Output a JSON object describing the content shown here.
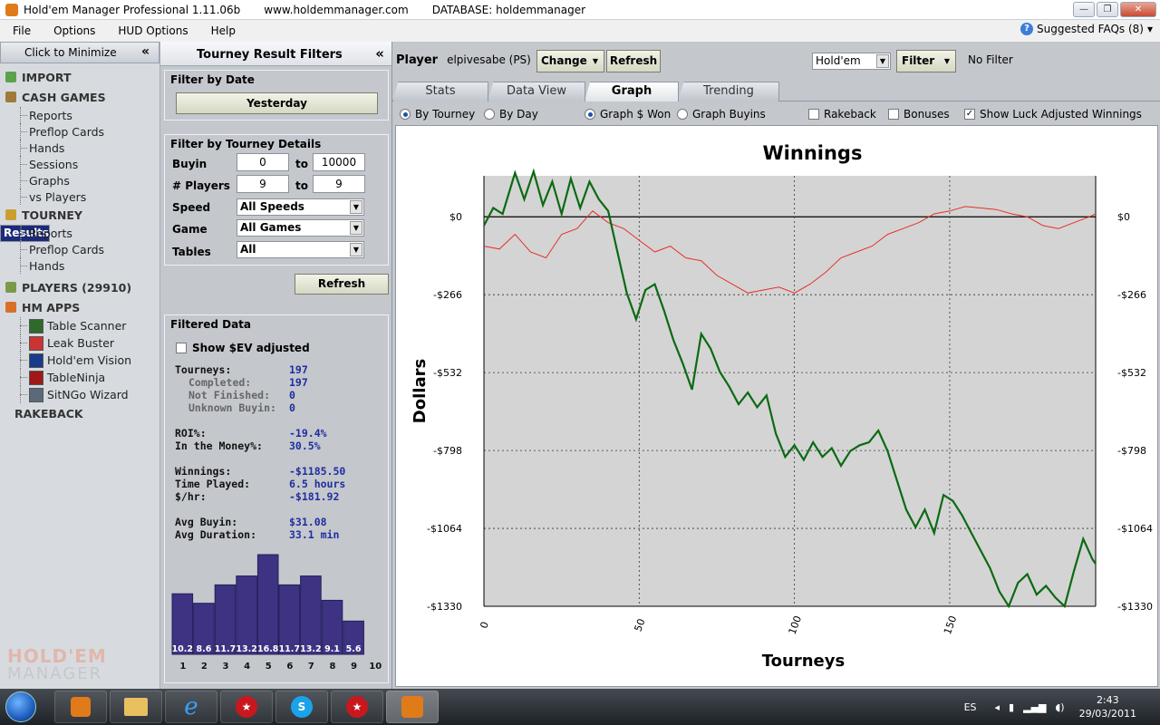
{
  "titlebar": {
    "app_title": "Hold'em Manager Professional 1.11.06b",
    "website": "www.holdemmanager.com",
    "database": "DATABASE: holdemmanager"
  },
  "menu": {
    "file": "File",
    "options": "Options",
    "hud_options": "HUD Options",
    "help": "Help",
    "faqs": "Suggested FAQs (8)"
  },
  "sidebar": {
    "minimize_label": "Click to Minimize",
    "import": "IMPORT",
    "cash_games": "CASH GAMES",
    "cash_items": [
      "Reports",
      "Preflop Cards",
      "Hands",
      "Sessions",
      "Graphs",
      "vs Players"
    ],
    "tourney": "TOURNEY",
    "tourney_items": [
      "Results",
      "Reports",
      "Preflop Cards",
      "Hands"
    ],
    "players": "PLAYERS (29910)",
    "hm_apps": "HM APPS",
    "apps": [
      "Table Scanner",
      "Leak Buster",
      "Hold'em Vision",
      "TableNinja",
      "SitNGo Wizard"
    ],
    "rakeback": "RAKEBACK",
    "logo_top": "HOLD'EM",
    "logo_bottom": "MANAGER"
  },
  "filters": {
    "title": "Tourney Result Filters",
    "by_date_title": "Filter by Date",
    "date_button": "Yesterday",
    "details_title": "Filter by Tourney Details",
    "buyin_label": "Buyin",
    "buyin_from": "0",
    "buyin_to": "10000",
    "players_label": "# Players",
    "players_from": "9",
    "players_to": "9",
    "to": "to",
    "speed_label": "Speed",
    "speed_value": "All Speeds",
    "game_label": "Game",
    "game_value": "All Games",
    "tables_label": "Tables",
    "tables_value": "All",
    "refresh": "Refresh",
    "filtered_title": "Filtered Data",
    "show_sev": "Show $EV adjusted",
    "stats": {
      "tourneys_label": "Tourneys:",
      "tourneys": "197",
      "completed_label": "Completed:",
      "completed": "197",
      "not_finished_label": "Not Finished:",
      "not_finished": "0",
      "unknown_label": "Unknown Buyin:",
      "unknown": "0",
      "roi_label": "ROI%:",
      "roi": "-19.4%",
      "itm_label": "In the Money%:",
      "itm": "30.5%",
      "winnings_label": "Winnings:",
      "winnings": "-$1185.50",
      "time_label": "Time Played:",
      "time": "6.5 hours",
      "hr_label": "$/hr:",
      "hr": "-$181.92",
      "avg_buyin_label": "Avg Buyin:",
      "avg_buyin": "$31.08",
      "avg_duration_label": "Avg Duration:",
      "avg_duration": "33.1 min"
    },
    "finish_histogram": {
      "positions": [
        "1",
        "2",
        "3",
        "4",
        "5",
        "6",
        "7",
        "8",
        "9",
        "10"
      ],
      "values": [
        10.2,
        8.6,
        11.7,
        13.2,
        16.8,
        11.7,
        13.2,
        9.1,
        5.6,
        null
      ],
      "labels": [
        "10.2",
        "8.6",
        "11.7",
        "13.2",
        "16.8",
        "11.7",
        "13.2",
        "9.1",
        "5.6",
        ""
      ],
      "max": 16.8
    }
  },
  "main": {
    "player_label": "Player",
    "player_name": "elpivesabe (PS)",
    "change": "Change",
    "refresh": "Refresh",
    "game_select": "Hold'em",
    "filter": "Filter",
    "no_filter": "No Filter",
    "tabs": [
      "Stats",
      "Data View",
      "Graph",
      "Trending"
    ],
    "options": {
      "by_tourney": "By Tourney",
      "by_day": "By Day",
      "graph_won": "Graph $ Won",
      "graph_buyins": "Graph Buyins",
      "rakeback": "Rakeback",
      "bonuses": "Bonuses",
      "luck": "Show Luck Adjusted Winnings"
    }
  },
  "chart_data": {
    "type": "line",
    "title": "Winnings",
    "xlabel": "Tourneys",
    "ylabel": "Dollars",
    "xlim": [
      0,
      197
    ],
    "ylim": [
      -1330,
      140
    ],
    "yticks": [
      0,
      -266,
      -532,
      -798,
      -1064,
      -1330
    ],
    "ytick_labels": [
      "$0",
      "-$266",
      "-$532",
      "-$798",
      "-$1064",
      "-$1330"
    ],
    "xticks": [
      0,
      50,
      100,
      150
    ],
    "grid": true,
    "colors": {
      "winnings": "#0b6a12",
      "luck_adjusted": "#e8302a"
    },
    "series": [
      {
        "key": "winnings",
        "x": [
          0,
          3,
          6,
          10,
          13,
          16,
          19,
          22,
          25,
          28,
          31,
          34,
          37,
          40,
          43,
          46,
          49,
          52,
          55,
          58,
          61,
          64,
          67,
          70,
          73,
          76,
          79,
          82,
          85,
          88,
          91,
          94,
          97,
          100,
          103,
          106,
          109,
          112,
          115,
          118,
          121,
          124,
          127,
          130,
          133,
          136,
          139,
          142,
          145,
          148,
          151,
          154,
          157,
          160,
          163,
          166,
          169,
          172,
          175,
          178,
          181,
          184,
          187,
          190,
          193,
          196,
          197
        ],
        "y": [
          -30,
          30,
          10,
          150,
          60,
          155,
          40,
          120,
          10,
          130,
          30,
          120,
          60,
          20,
          -120,
          -260,
          -350,
          -250,
          -230,
          -320,
          -420,
          -500,
          -590,
          -400,
          -450,
          -530,
          -580,
          -640,
          -600,
          -650,
          -610,
          -740,
          -820,
          -780,
          -830,
          -770,
          -820,
          -790,
          -850,
          -800,
          -780,
          -770,
          -730,
          -800,
          -900,
          -1000,
          -1060,
          -1000,
          -1080,
          -950,
          -970,
          -1020,
          -1080,
          -1140,
          -1200,
          -1280,
          -1330,
          -1250,
          -1220,
          -1290,
          -1260,
          -1300,
          -1330,
          -1210,
          -1100,
          -1170,
          -1185
        ]
      },
      {
        "key": "luck_adjusted",
        "x": [
          0,
          5,
          10,
          15,
          20,
          25,
          30,
          35,
          40,
          45,
          50,
          55,
          60,
          65,
          70,
          75,
          80,
          85,
          90,
          95,
          100,
          105,
          110,
          115,
          120,
          125,
          130,
          135,
          140,
          145,
          150,
          155,
          160,
          165,
          170,
          175,
          180,
          185,
          190,
          195,
          197
        ],
        "y": [
          -100,
          -110,
          -60,
          -120,
          -140,
          -60,
          -40,
          20,
          -20,
          -40,
          -80,
          -120,
          -100,
          -140,
          -150,
          -200,
          -230,
          -260,
          -250,
          -240,
          -260,
          -230,
          -190,
          -140,
          -120,
          -100,
          -60,
          -40,
          -20,
          10,
          20,
          35,
          30,
          25,
          10,
          0,
          -30,
          -40,
          -20,
          0,
          10
        ]
      }
    ]
  },
  "taskbar": {
    "lang": "ES",
    "time": "2:43",
    "date": "29/03/2011"
  }
}
